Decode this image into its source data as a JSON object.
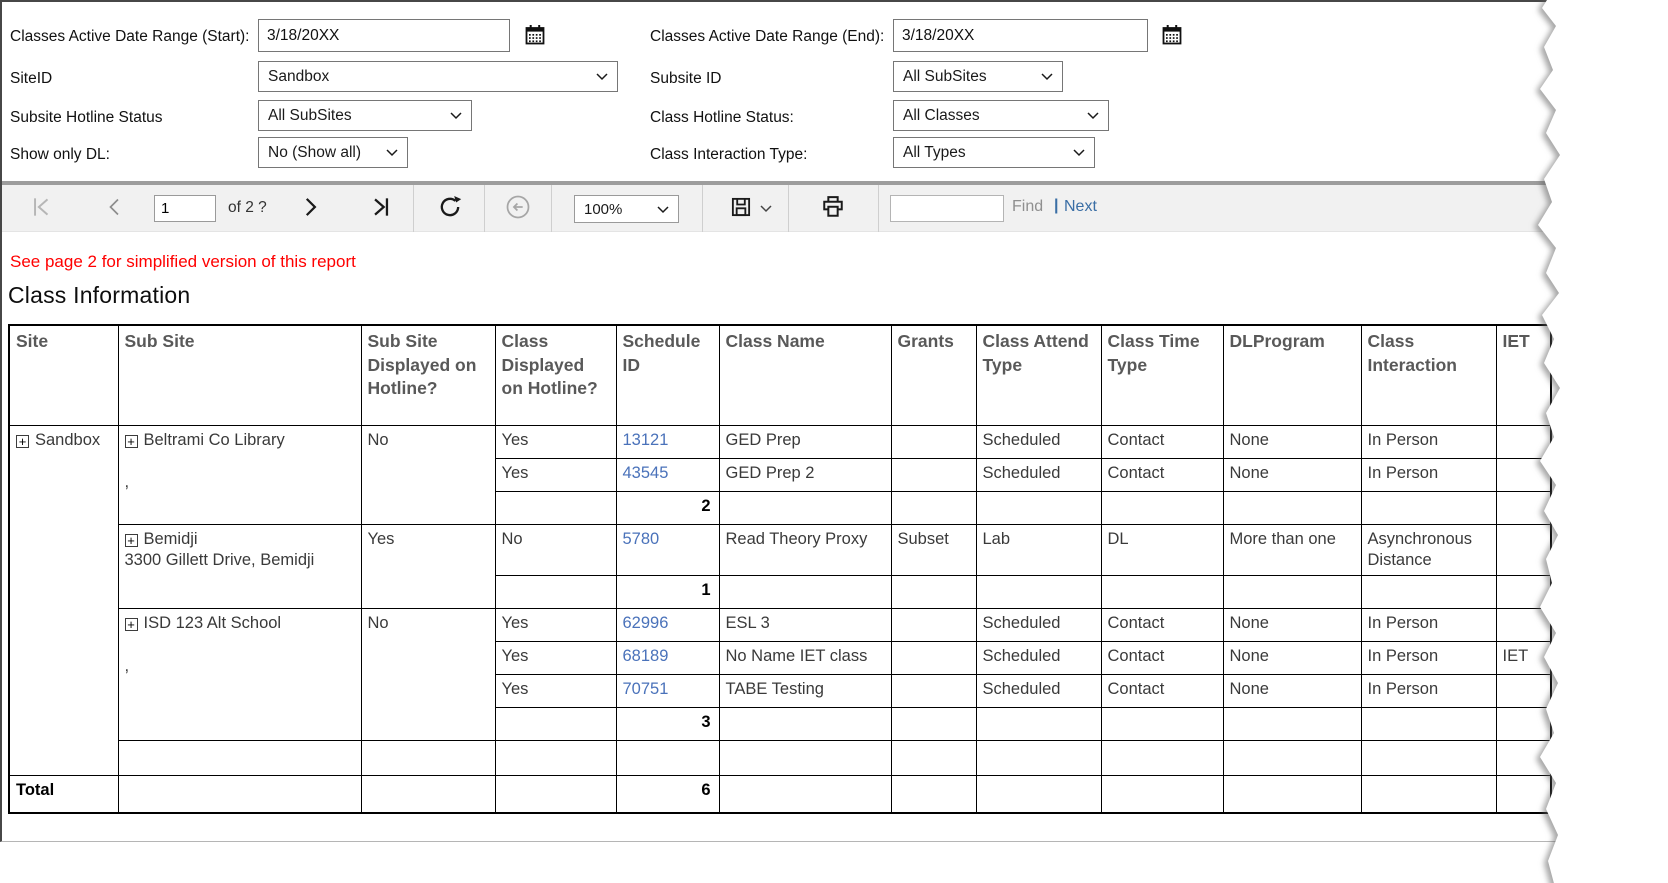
{
  "filters": {
    "left": [
      {
        "label": "Classes Active Date Range (Start):",
        "value": "3/18/20XX"
      },
      {
        "label": "SiteID",
        "value": "Sandbox"
      },
      {
        "label": "Subsite Hotline Status",
        "value": "All SubSites"
      },
      {
        "label": "Show only DL:",
        "value": "No (Show all)"
      }
    ],
    "right": [
      {
        "label": "Classes Active Date Range (End):",
        "value": "3/18/20XX"
      },
      {
        "label": "Subsite ID",
        "value": "All SubSites"
      },
      {
        "label": "Class Hotline Status:",
        "value": "All Classes"
      },
      {
        "label": "Class Interaction Type:",
        "value": "All Types"
      }
    ]
  },
  "toolbar": {
    "page_value": "1",
    "of_label": "of 2 ?",
    "zoom_value": "100%",
    "find_label": "Find",
    "separator": "|",
    "next_label": "Next"
  },
  "icons": {
    "calendar-icon": "calendar grid",
    "first-page-icon": "bar + left triangle",
    "prev-page-icon": "left chevron",
    "next-page-icon": "right chevron",
    "last-page-icon": "right triangle + bar",
    "refresh-icon": "circular clockwise arrow",
    "back-icon": "circled left arrow",
    "save-icon": "floppy disk",
    "chevron-down-icon": "down chevron",
    "print-icon": "printer",
    "expand-icon": "boxed plus"
  },
  "note": "See page 2 for simplified version of this report",
  "report_title": "Class Information",
  "report_table": {
    "columns": [
      "Site",
      "Sub Site",
      "Sub Site Displayed on Hotline?",
      "Class Displayed on Hotline?",
      "Schedule ID",
      "Class Name",
      "Grants",
      "Class Attend Type",
      "Class Time Type",
      "DLProgram",
      "Class Interaction",
      "IET"
    ],
    "site": "Sandbox",
    "groups": [
      {
        "name": "Beltrami Co Library",
        "address": "\n,",
        "displayed_on_hotline": "No",
        "subtotal": "2",
        "classes": [
          {
            "displayed": "Yes",
            "schedule_id": "13121",
            "class_name": "GED Prep",
            "grants": "",
            "attend_type": "Scheduled",
            "time_type": "Contact",
            "dl_program": "None",
            "interaction": "In Person",
            "iet": ""
          },
          {
            "displayed": "Yes",
            "schedule_id": "43545",
            "class_name": "GED Prep 2",
            "grants": "",
            "attend_type": "Scheduled",
            "time_type": "Contact",
            "dl_program": "None",
            "interaction": "In Person",
            "iet": ""
          }
        ]
      },
      {
        "name": "Bemidji",
        "address": "3300 Gillett Drive, Bemidji",
        "displayed_on_hotline": "Yes",
        "subtotal": "1",
        "classes": [
          {
            "displayed": "No",
            "schedule_id": "5780",
            "class_name": "Read Theory Proxy",
            "grants": "Subset",
            "attend_type": "Lab",
            "time_type": "DL",
            "dl_program": "More than one",
            "interaction": "Asynchronous Distance",
            "iet": ""
          }
        ]
      },
      {
        "name": "ISD 123 Alt School",
        "address": "\n,",
        "displayed_on_hotline": "No",
        "subtotal": "3",
        "classes": [
          {
            "displayed": "Yes",
            "schedule_id": "62996",
            "class_name": "ESL 3",
            "grants": "",
            "attend_type": "Scheduled",
            "time_type": "Contact",
            "dl_program": "None",
            "interaction": "In Person",
            "iet": ""
          },
          {
            "displayed": "Yes",
            "schedule_id": "68189",
            "class_name": "No Name IET class",
            "grants": "",
            "attend_type": "Scheduled",
            "time_type": "Contact",
            "dl_program": "None",
            "interaction": "In Person",
            "iet": "IET"
          },
          {
            "displayed": "Yes",
            "schedule_id": "70751",
            "class_name": "TABE Testing",
            "grants": "",
            "attend_type": "Scheduled",
            "time_type": "Contact",
            "dl_program": "None",
            "interaction": "In Person",
            "iet": ""
          }
        ]
      }
    ],
    "total_label": "Total",
    "total_value": "6"
  }
}
